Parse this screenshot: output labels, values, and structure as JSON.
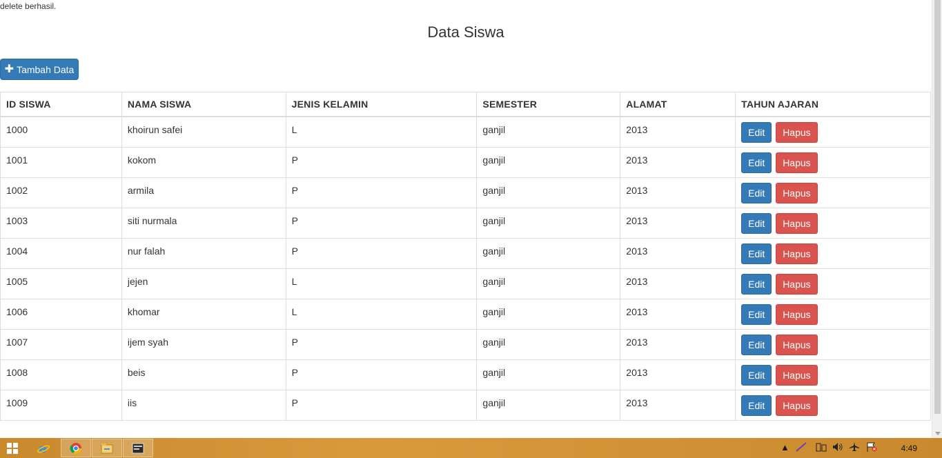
{
  "status_message": "delete berhasil.",
  "page_title": "Data Siswa",
  "add_button_label": "Tambah Data",
  "table": {
    "headers": [
      "ID SISWA",
      "NAMA SISWA",
      "JENIS KELAMIN",
      "SEMESTER",
      "ALAMAT",
      "TAHUN AJARAN"
    ],
    "rows": [
      {
        "id": "1000",
        "nama": "khoirun safei",
        "jk": "L",
        "semester": "ganjil",
        "alamat": "2013"
      },
      {
        "id": "1001",
        "nama": "kokom",
        "jk": "P",
        "semester": "ganjil",
        "alamat": "2013"
      },
      {
        "id": "1002",
        "nama": "armila",
        "jk": "P",
        "semester": "ganjil",
        "alamat": "2013"
      },
      {
        "id": "1003",
        "nama": "siti nurmala",
        "jk": "P",
        "semester": "ganjil",
        "alamat": "2013"
      },
      {
        "id": "1004",
        "nama": "nur falah",
        "jk": "P",
        "semester": "ganjil",
        "alamat": "2013"
      },
      {
        "id": "1005",
        "nama": "jejen",
        "jk": "L",
        "semester": "ganjil",
        "alamat": "2013"
      },
      {
        "id": "1006",
        "nama": "khomar",
        "jk": "L",
        "semester": "ganjil",
        "alamat": "2013"
      },
      {
        "id": "1007",
        "nama": "ijem syah",
        "jk": "P",
        "semester": "ganjil",
        "alamat": "2013"
      },
      {
        "id": "1008",
        "nama": "beis",
        "jk": "P",
        "semester": "ganjil",
        "alamat": "2013"
      },
      {
        "id": "1009",
        "nama": "iis",
        "jk": "P",
        "semester": "ganjil",
        "alamat": "2013"
      }
    ],
    "edit_label": "Edit",
    "delete_label": "Hapus"
  },
  "taskbar": {
    "clock": "4:49",
    "apps": [
      "internet-explorer-icon",
      "chrome-icon",
      "file-explorer-icon",
      "terminal-icon"
    ]
  },
  "colors": {
    "primary": "#337ab7",
    "danger": "#d9534f",
    "taskbar": "#c98a2e"
  }
}
